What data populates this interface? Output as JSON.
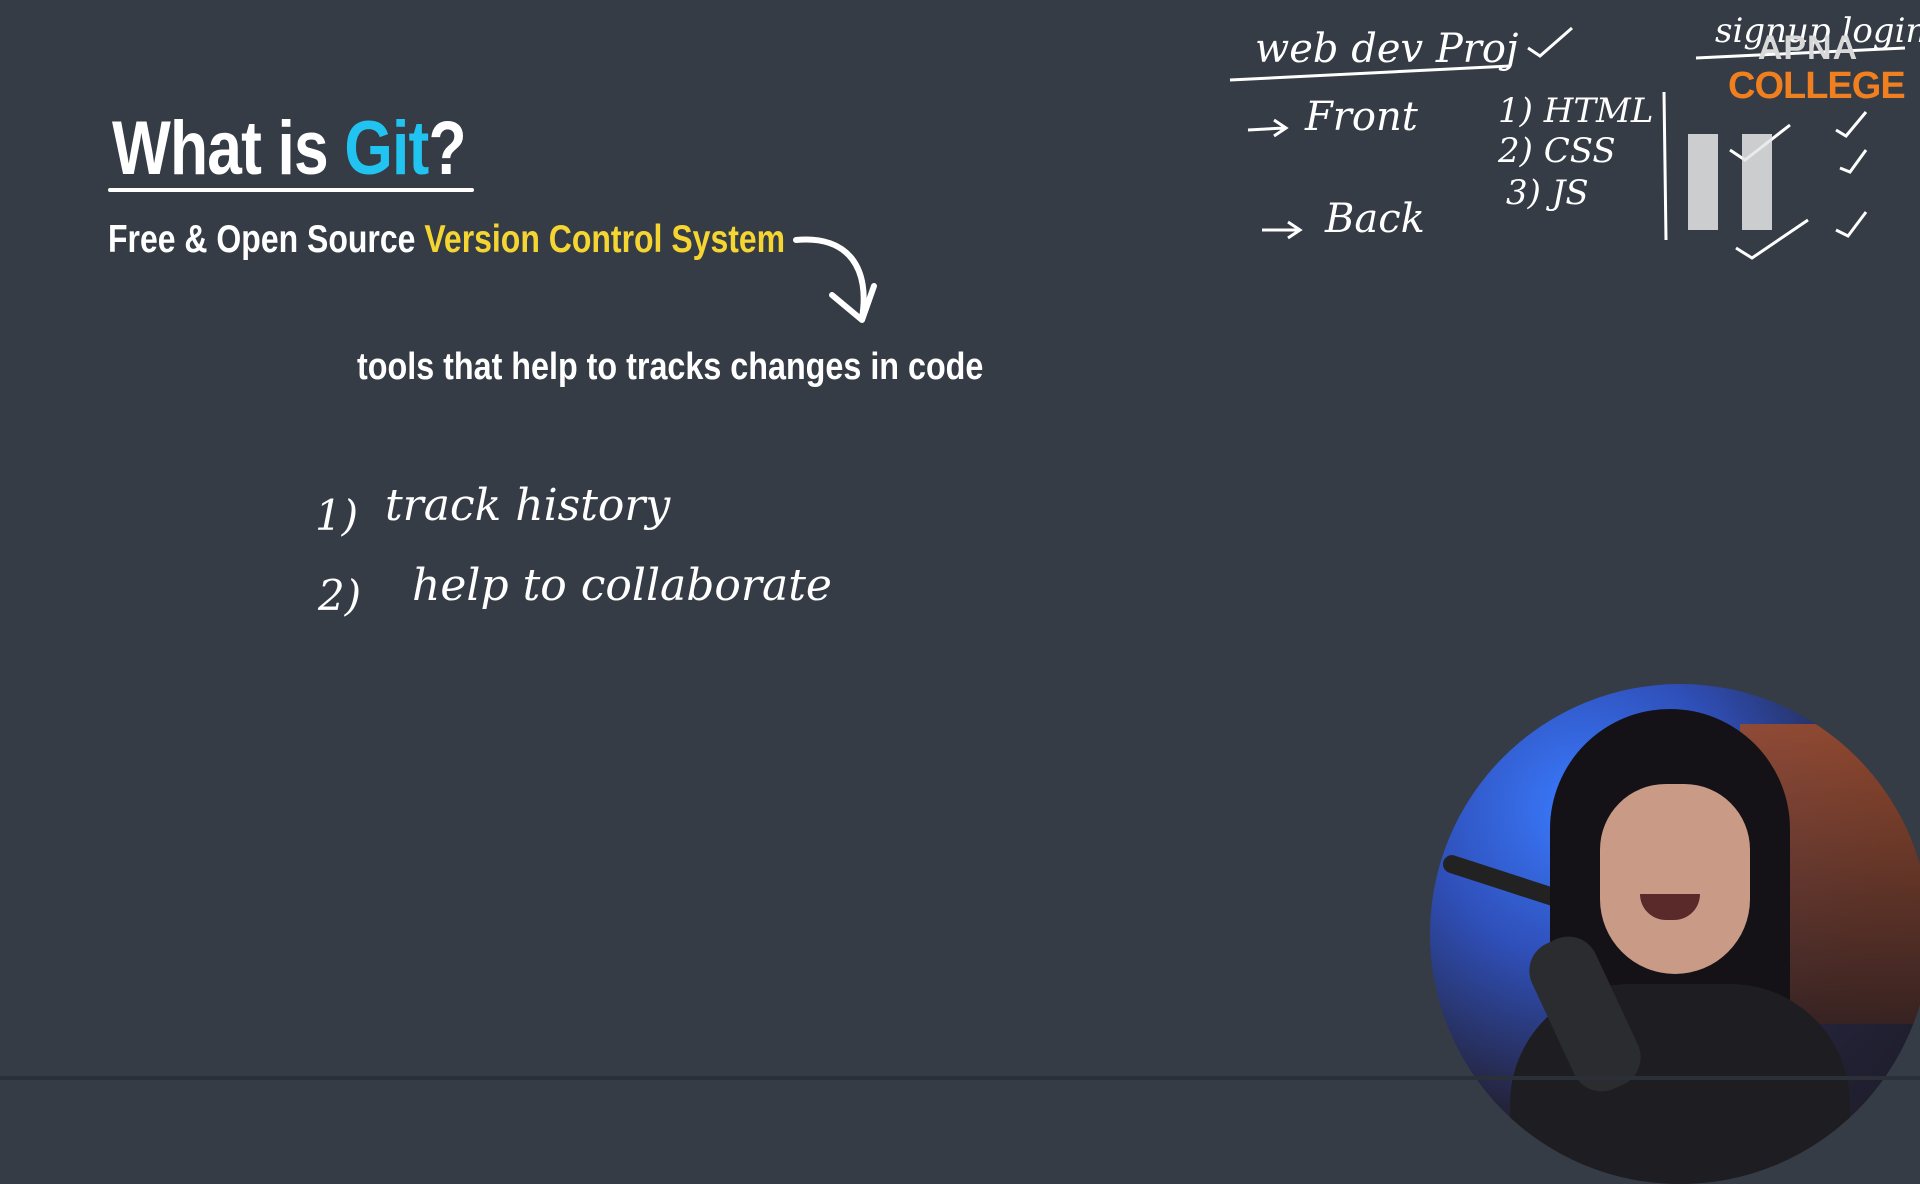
{
  "slide": {
    "title_prefix": "What is ",
    "title_highlight": "Git",
    "title_suffix": "?",
    "subtitle_prefix": "Free & Open Source ",
    "subtitle_highlight": "Version Control System",
    "definition": "tools that help to tracks changes in code"
  },
  "handwritten_notes": {
    "points": [
      {
        "number": "1)",
        "text": "track history"
      },
      {
        "number": "2)",
        "text": "help to collaborate"
      }
    ],
    "top_right": {
      "heading": "web dev Proj",
      "front": "Front",
      "back": "Back",
      "list": [
        "1) HTML",
        "2) CSS",
        "3) JS"
      ],
      "side_heading": "signup login"
    }
  },
  "brand": {
    "line1": "APNA",
    "line2": "COLLEGE"
  },
  "colors": {
    "background": "#353c45",
    "git_accent": "#21c3f0",
    "vcs_accent": "#f5d531",
    "brand_orange": "#f07f1f"
  },
  "icons": {
    "pause": "pause-icon",
    "arrow": "curved-arrow-icon"
  }
}
